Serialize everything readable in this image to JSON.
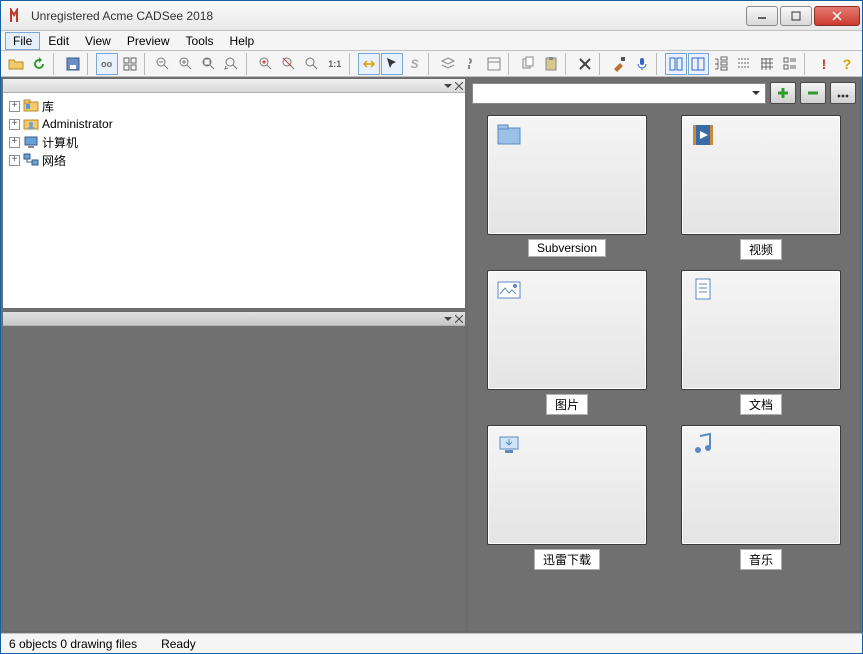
{
  "window": {
    "title": "Unregistered Acme CADSee 2018"
  },
  "menu": {
    "items": [
      "File",
      "Edit",
      "View",
      "Preview",
      "Tools",
      "Help"
    ]
  },
  "toolbar": {
    "zoom_11": "1:1",
    "s_label": "S",
    "oo_label": "oo",
    "excl": "!",
    "qmark": "?"
  },
  "sidebar": {
    "items": [
      {
        "label": "库"
      },
      {
        "label": "Administrator"
      },
      {
        "label": "计算机"
      },
      {
        "label": "网络"
      }
    ]
  },
  "addressbar": {
    "value": ""
  },
  "thumbs": [
    {
      "label": "Subversion"
    },
    {
      "label": "视频"
    },
    {
      "label": "图片"
    },
    {
      "label": "文档"
    },
    {
      "label": "迅雷下载"
    },
    {
      "label": "音乐"
    }
  ],
  "status": {
    "left": "6 objects 0 drawing files",
    "right": "Ready"
  }
}
